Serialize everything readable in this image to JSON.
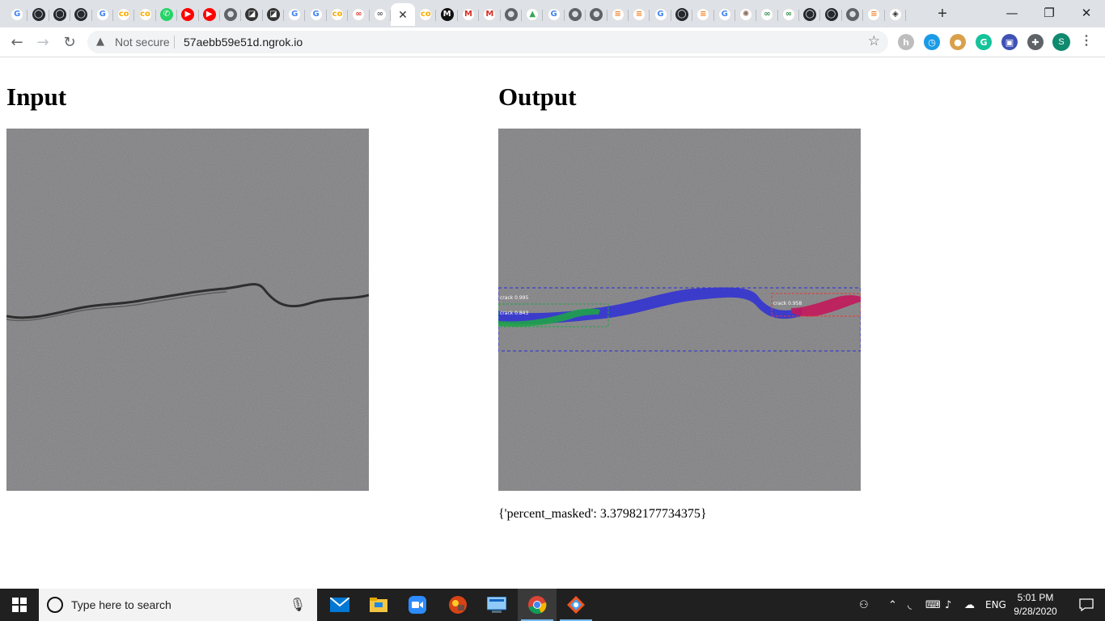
{
  "browser": {
    "tabs": [
      {
        "icon": "google-icon",
        "glyph": "G",
        "bg": "#ffffff",
        "fg": "#4285f4"
      },
      {
        "icon": "github-icon",
        "glyph": "◯",
        "bg": "#24292e",
        "fg": "#ffffff"
      },
      {
        "icon": "github-icon",
        "glyph": "◯",
        "bg": "#24292e",
        "fg": "#ffffff"
      },
      {
        "icon": "github-icon",
        "glyph": "◯",
        "bg": "#24292e",
        "fg": "#ffffff"
      },
      {
        "icon": "google-icon",
        "glyph": "G",
        "bg": "#ffffff",
        "fg": "#4285f4"
      },
      {
        "icon": "colab-icon",
        "glyph": "co",
        "bg": "#ffffff",
        "fg": "#f9ab00"
      },
      {
        "icon": "colab-icon",
        "glyph": "co",
        "bg": "#ffffff",
        "fg": "#f9ab00"
      },
      {
        "icon": "whatsapp-icon",
        "glyph": "✆",
        "bg": "#25d366",
        "fg": "#ffffff"
      },
      {
        "icon": "youtube-icon",
        "glyph": "▶",
        "bg": "#ff0000",
        "fg": "#ffffff"
      },
      {
        "icon": "youtube-icon",
        "glyph": "▶",
        "bg": "#ff0000",
        "fg": "#ffffff"
      },
      {
        "icon": "globe-icon",
        "glyph": "●",
        "bg": "#5f6368",
        "fg": "#dadce0"
      },
      {
        "icon": "notion-icon",
        "glyph": "◪",
        "bg": "#333333",
        "fg": "#ffffff"
      },
      {
        "icon": "notion-icon",
        "glyph": "◪",
        "bg": "#333333",
        "fg": "#ffffff"
      },
      {
        "icon": "google-icon",
        "glyph": "G",
        "bg": "#ffffff",
        "fg": "#4285f4"
      },
      {
        "icon": "google-icon",
        "glyph": "G",
        "bg": "#ffffff",
        "fg": "#4285f4"
      },
      {
        "icon": "colab-icon",
        "glyph": "co",
        "bg": "#ffffff",
        "fg": "#f9ab00"
      },
      {
        "icon": "infinity-icon",
        "glyph": "∞",
        "bg": "#ffffff",
        "fg": "#e53935"
      },
      {
        "icon": "infinity-icon",
        "glyph": "∞",
        "bg": "#ffffff",
        "fg": "#5f6368"
      },
      {
        "icon": "globe-icon",
        "glyph": "●",
        "bg": "#5f6368",
        "fg": "#dadce0"
      },
      {
        "icon": "colab-icon",
        "glyph": "co",
        "bg": "#ffffff",
        "fg": "#f9ab00"
      },
      {
        "icon": "medium-icon",
        "glyph": "M",
        "bg": "#111111",
        "fg": "#ffffff"
      },
      {
        "icon": "gmail-icon",
        "glyph": "M",
        "bg": "#ffffff",
        "fg": "#d93025"
      },
      {
        "icon": "gmail-icon",
        "glyph": "M",
        "bg": "#ffffff",
        "fg": "#d93025"
      },
      {
        "icon": "globe-icon",
        "glyph": "●",
        "bg": "#5f6368",
        "fg": "#dadce0"
      },
      {
        "icon": "drive-icon",
        "glyph": "▲",
        "bg": "#ffffff",
        "fg": "#34a853"
      },
      {
        "icon": "google-icon",
        "glyph": "G",
        "bg": "#ffffff",
        "fg": "#4285f4"
      },
      {
        "icon": "globe-icon",
        "glyph": "●",
        "bg": "#5f6368",
        "fg": "#dadce0"
      },
      {
        "icon": "globe-icon",
        "glyph": "●",
        "bg": "#5f6368",
        "fg": "#dadce0"
      },
      {
        "icon": "stackoverflow-icon",
        "glyph": "≡",
        "bg": "#ffffff",
        "fg": "#f48024"
      },
      {
        "icon": "stackoverflow-icon",
        "glyph": "≡",
        "bg": "#ffffff",
        "fg": "#f48024"
      },
      {
        "icon": "google-icon",
        "glyph": "G",
        "bg": "#ffffff",
        "fg": "#4285f4"
      },
      {
        "icon": "github-icon",
        "glyph": "◯",
        "bg": "#24292e",
        "fg": "#ffffff"
      },
      {
        "icon": "stackoverflow-icon",
        "glyph": "≡",
        "bg": "#ffffff",
        "fg": "#f48024"
      },
      {
        "icon": "google-icon",
        "glyph": "G",
        "bg": "#ffffff",
        "fg": "#4285f4"
      },
      {
        "icon": "compass-icon",
        "glyph": "✺",
        "bg": "#ffffff",
        "fg": "#8d6e63"
      },
      {
        "icon": "geeksforgeeks-icon",
        "glyph": "∞",
        "bg": "#ffffff",
        "fg": "#2f8d46"
      },
      {
        "icon": "geeksforgeeks-icon",
        "glyph": "∞",
        "bg": "#ffffff",
        "fg": "#2f8d46"
      },
      {
        "icon": "github-icon",
        "glyph": "◯",
        "bg": "#24292e",
        "fg": "#ffffff"
      },
      {
        "icon": "github-icon",
        "glyph": "◯",
        "bg": "#24292e",
        "fg": "#ffffff"
      },
      {
        "icon": "globe-icon",
        "glyph": "●",
        "bg": "#5f6368",
        "fg": "#dadce0"
      },
      {
        "icon": "stackoverflow-icon",
        "glyph": "≡",
        "bg": "#ffffff",
        "fg": "#f48024"
      },
      {
        "icon": "diamond-icon",
        "glyph": "◈",
        "bg": "#ffffff",
        "fg": "#333333"
      }
    ],
    "active_tab_index": 18,
    "new_tab_glyph": "+",
    "window_controls": {
      "minimize": "—",
      "restore": "❐",
      "close": "✕"
    },
    "nav": {
      "back": "←",
      "forward": "→",
      "reload": "↻"
    },
    "security_warning_glyph": "▲",
    "security_label": "Not secure",
    "url": "57aebb59e51d.ngrok.io",
    "bookmark_glyph": "☆",
    "extensions": [
      {
        "icon": "extension-h-icon",
        "glyph": "h",
        "bg": "#bdbdbd"
      },
      {
        "icon": "clock-extension-icon",
        "glyph": "◷",
        "bg": "#1a9be6"
      },
      {
        "icon": "cookie-extension-icon",
        "glyph": "●",
        "bg": "#d9a04b"
      },
      {
        "icon": "grammarly-icon",
        "glyph": "G",
        "bg": "#15c39a"
      },
      {
        "icon": "bus-extension-icon",
        "glyph": "▣",
        "bg": "#3f51b5"
      },
      {
        "icon": "puzzle-extensions-icon",
        "glyph": "✚",
        "bg": "#5f6368"
      }
    ],
    "profile_initial": "S",
    "menu_glyph": "⋮"
  },
  "page": {
    "input_heading": "Input",
    "output_heading": "Output",
    "result_text": "{'percent_masked': 3.37982177734375}",
    "detections": [
      {
        "label": "crack 0.995",
        "color": "#2b2bd9"
      },
      {
        "label": "crack 0.843",
        "color": "#1fa34a"
      },
      {
        "label": "crack 0.958",
        "color": "#c2185b"
      }
    ]
  },
  "taskbar": {
    "search_placeholder": "Type here to search",
    "tray_language": "ENG",
    "clock_time": "5:01 PM",
    "clock_date": "9/28/2020"
  }
}
